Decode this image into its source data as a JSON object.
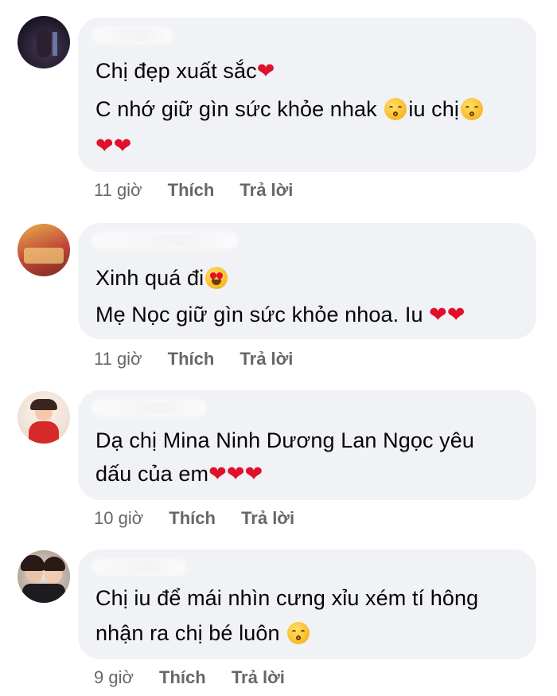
{
  "comments": [
    {
      "lines": [
        "Chị đẹp xuất sắc",
        "C nhớ giữ gìn sức khỏe nhak",
        "iu chị"
      ],
      "time": "11 giờ",
      "like": "Thích",
      "reply": "Trả lời"
    },
    {
      "lines": [
        "Xinh quá đi",
        "Mẹ Nọc giữ gìn sức khỏe nhoa. Iu"
      ],
      "time": "11 giờ",
      "like": "Thích",
      "reply": "Trả lời"
    },
    {
      "lines": [
        " Dạ chị Mina Ninh Dương Lan Ngọc yêu",
        "dấu của em"
      ],
      "time": "10 giờ",
      "like": "Thích",
      "reply": "Trả lời"
    },
    {
      "lines": [
        "Chị iu để mái nhìn cưng xỉu xém tí hông",
        "nhận ra chị bé luôn "
      ],
      "time": "9 giờ",
      "like": "Thích",
      "reply": "Trả lời"
    }
  ],
  "icons": {
    "heart": "❤",
    "kissing": "kissing-face-icon",
    "wink_kiss": "face-blowing-kiss-icon",
    "heart_eyes": "heart-eyes-face-icon"
  }
}
